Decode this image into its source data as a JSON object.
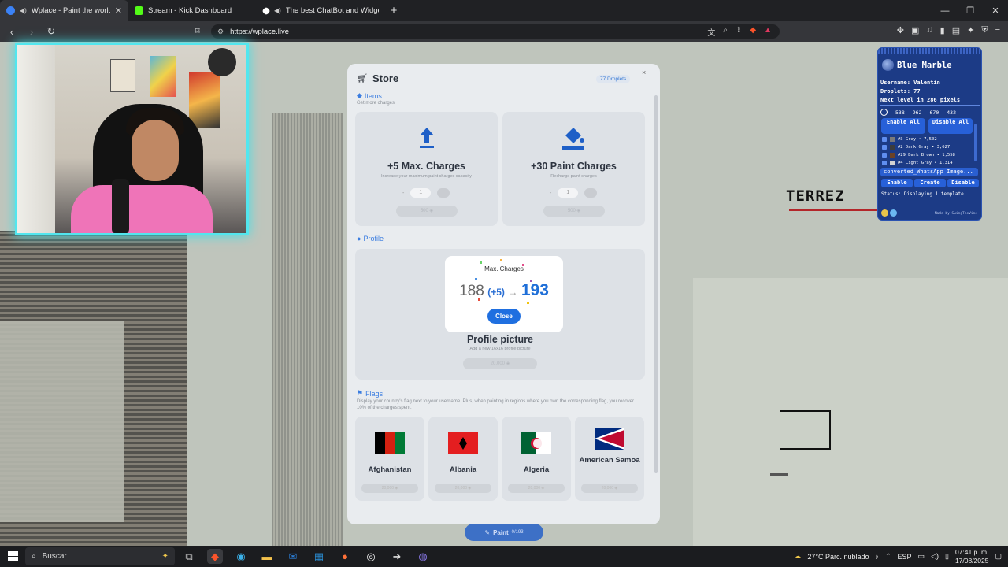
{
  "browser": {
    "tabs": [
      {
        "label": "Wplace - Paint the world",
        "active": true,
        "color": "#3b82f6"
      },
      {
        "label": "Stream - Kick Dashboard",
        "active": false,
        "color": "#53fc18"
      },
      {
        "label": "The best ChatBot and Widgets fo",
        "active": false,
        "color": "#ffffff"
      }
    ],
    "url": "https://wplace.live"
  },
  "store": {
    "title": "Store",
    "droplets_badge": "77 Droplets",
    "close_glyph": "×",
    "items_heading": "Items",
    "items_sub": "Get more charges",
    "items": [
      {
        "title": "+5 Max. Charges",
        "sub": "Increase your maximum paint charges capacity",
        "qty": "1",
        "buy": "500 ◈"
      },
      {
        "title": "+30 Paint Charges",
        "sub": "Recharge paint charges",
        "qty": "1",
        "buy": "500 ◈"
      }
    ],
    "profile_heading": "Profile",
    "profile_item": {
      "title": "Profile picture",
      "sub": "Add a new 16x16 profile picture",
      "buy": "20,000 ◈"
    },
    "flags_heading": "Flags",
    "flags_desc": "Display your country's flag next to your username. Plus, when painting in regions where you own the corresponding flag, you recover 10% of the charges spent.",
    "flags": [
      {
        "name": "Afghanistan",
        "buy": "20,000 ◈"
      },
      {
        "name": "Albania",
        "buy": "20,000 ◈"
      },
      {
        "name": "Algeria",
        "buy": "20,000 ◈"
      },
      {
        "name": "American Samoa",
        "buy": "20,000 ◈"
      }
    ]
  },
  "popup": {
    "title": "Max. Charges",
    "old_value": "188",
    "added": "(+5)",
    "arrow": "→",
    "new_value": "193",
    "close_label": "Close"
  },
  "paint_button": {
    "label": "Paint",
    "count": "0/193"
  },
  "blue_marble": {
    "title": "Blue Marble",
    "username": "Username: Valentin",
    "droplets": "Droplets: 77",
    "next_level": "Next level in 286 pixels",
    "coords": [
      "538",
      "962",
      "670",
      "432"
    ],
    "enable_all": "Enable All",
    "disable_all": "Disable All",
    "colors": [
      {
        "label": "#3 Gray • 7,502",
        "swatch": "#7a7a7a"
      },
      {
        "label": "#2 Dark Gray • 3,627",
        "swatch": "#3c3c3c"
      },
      {
        "label": "#29 Dark Brown • 1,558",
        "swatch": "#6b4226"
      },
      {
        "label": "#4 Light Gray • 1,314",
        "swatch": "#d2d2d2"
      }
    ],
    "file": "converted_WhatsApp Image...",
    "enable": "Enable",
    "create": "Create",
    "disable": "Disable",
    "status": "Status: Displaying 1 template.",
    "footer": "Made by SwingTheVine"
  },
  "map_text": "TERREZ",
  "taskbar": {
    "search_placeholder": "Buscar",
    "weather": "27°C  Parc. nublado",
    "lang": "ESP",
    "time": "07:41 p. m.",
    "date": "17/08/2025"
  }
}
